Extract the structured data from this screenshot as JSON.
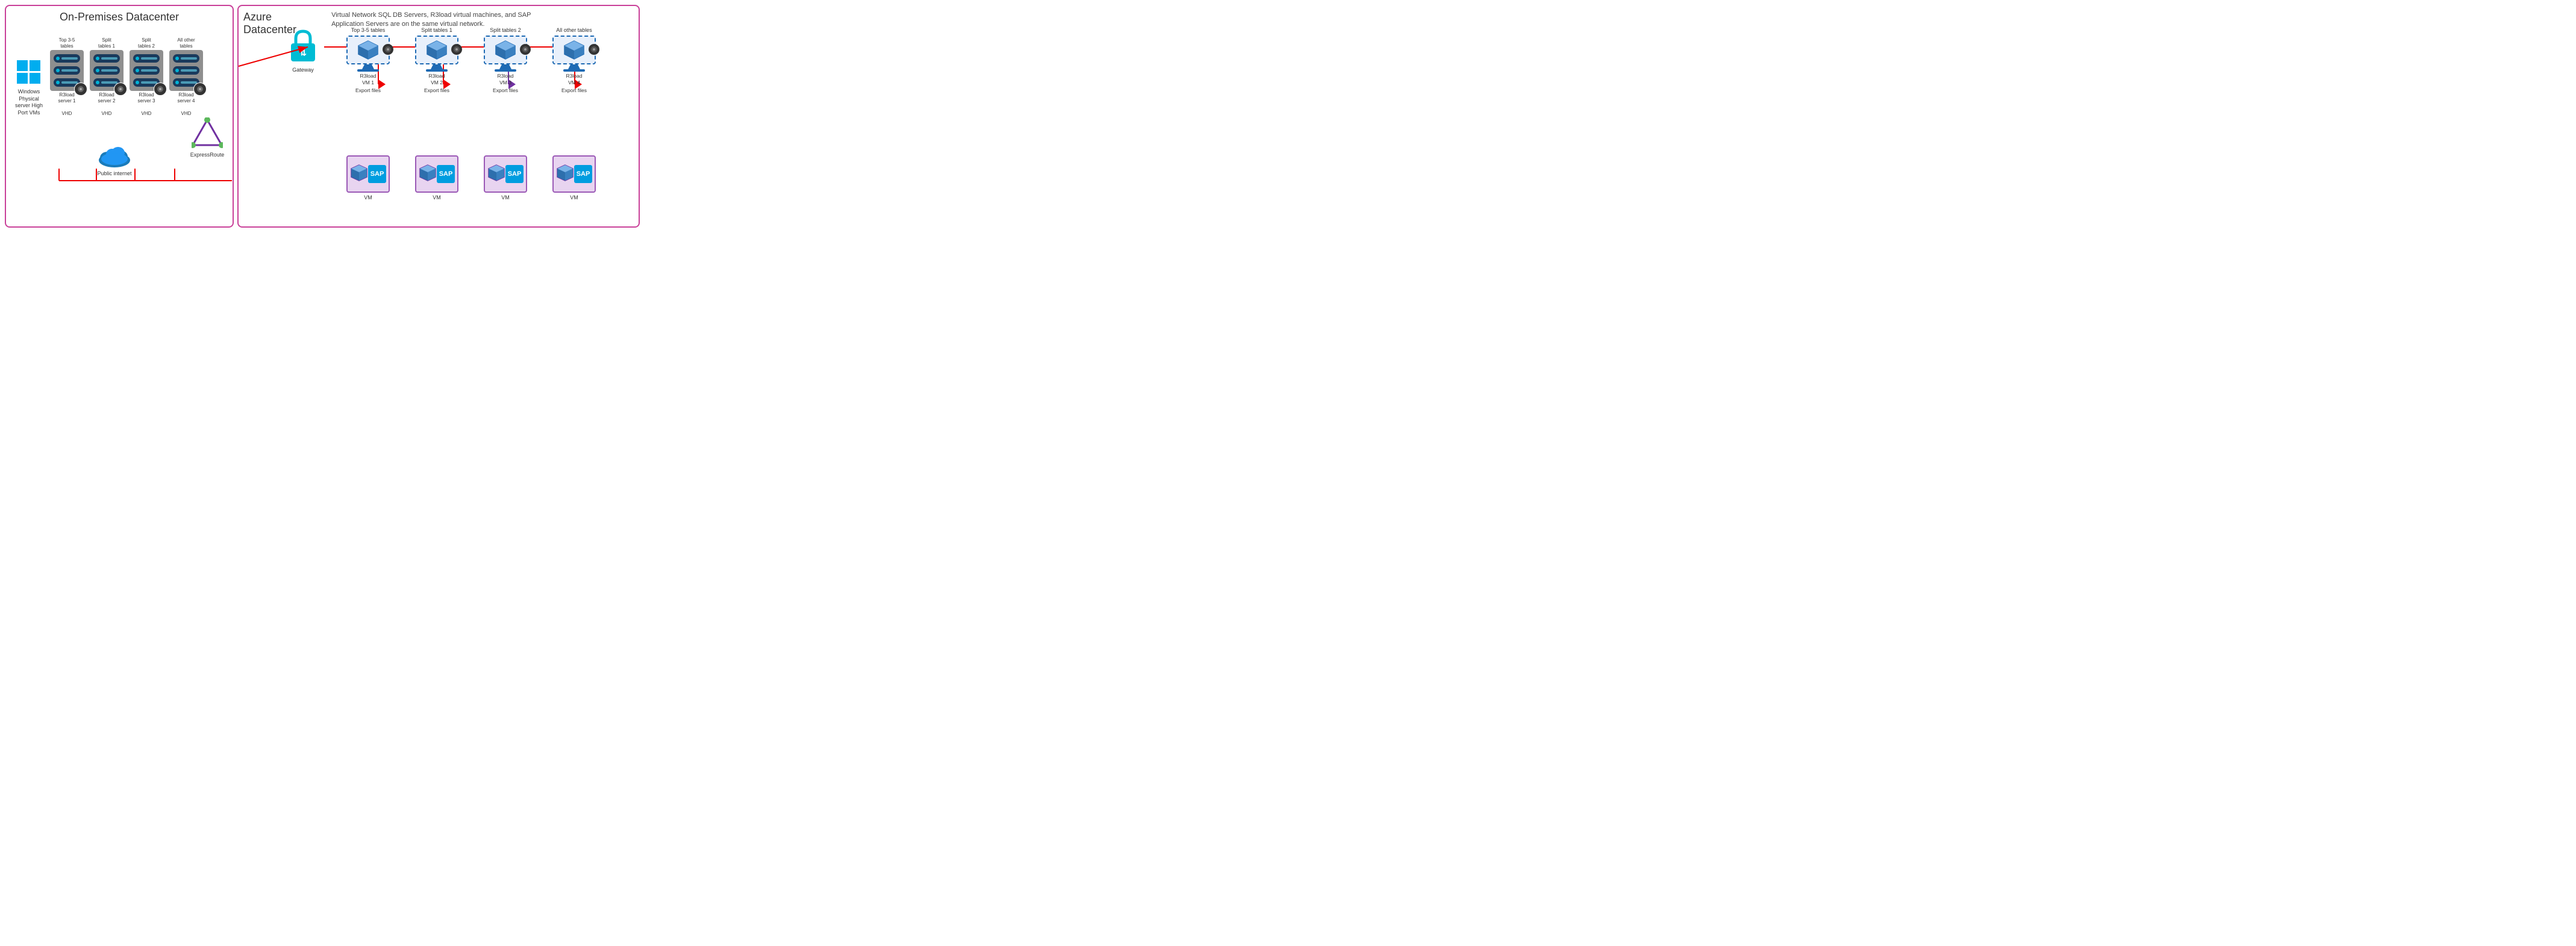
{
  "onPremises": {
    "title": "On-Premises Datacenter",
    "windows": {
      "label": "Windows Physical server High Port VMs"
    },
    "servers": [
      {
        "label": "Top 3-5\ntables",
        "serverLabel": "R3load\nserver 1",
        "vhd": "VHD"
      },
      {
        "label": "Split\ntables 1",
        "serverLabel": "R3load\nserver 2",
        "vhd": "VHD"
      },
      {
        "label": "Split\ntables 2",
        "serverLabel": "R3load\nserver 3",
        "vhd": "VHD"
      },
      {
        "label": "All other\ntables",
        "serverLabel": "R3load\nserver 4",
        "vhd": "VHD"
      }
    ],
    "expressRoute": {
      "label": "ExpressRoute"
    },
    "publicInternet": {
      "label": "Public internet"
    }
  },
  "azure": {
    "title": "Azure\nDatacenter",
    "subtitle": "Virtual Network SQL DB Servers, R3load virtual machines, and SAP Application Servers are on the same virtual network.",
    "gateway": {
      "label": "Gateway"
    },
    "vmGroups": [
      {
        "topLabel": "Top 3-5 tables",
        "vmLabel": "R3load\nVM 1",
        "exportLabel": "Export files"
      },
      {
        "topLabel": "Split tables 1",
        "vmLabel": "R3load\nVM 2",
        "exportLabel": "Export files"
      },
      {
        "topLabel": "Split tables 2",
        "vmLabel": "R3load\nVM 3",
        "exportLabel": "Export files"
      },
      {
        "topLabel": "All other tables",
        "vmLabel": "R3load\nVM 4",
        "exportLabel": "Export files"
      }
    ],
    "sapVms": [
      {
        "label": "VM"
      },
      {
        "label": "VM"
      },
      {
        "label": "VM"
      },
      {
        "label": "VM"
      }
    ]
  }
}
